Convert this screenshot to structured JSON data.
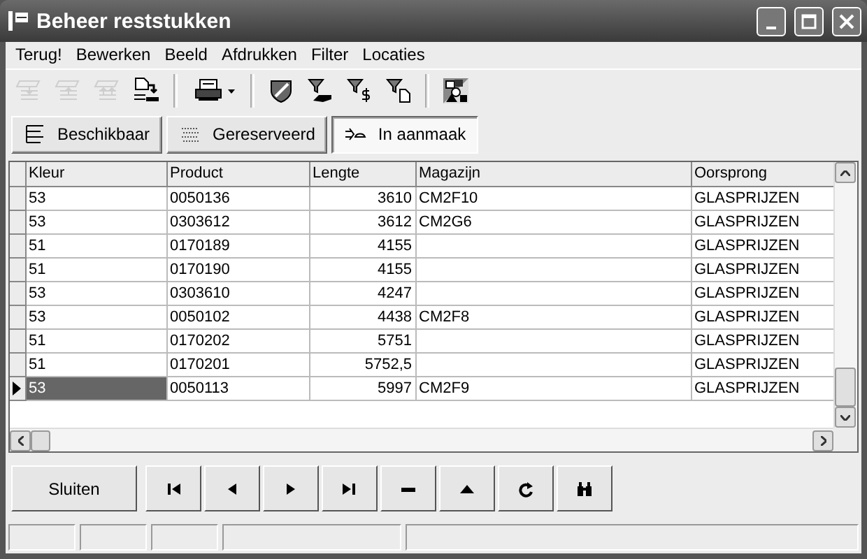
{
  "window": {
    "title": "Beheer reststukken"
  },
  "menu": [
    "Terug!",
    "Bewerken",
    "Beeld",
    "Afdrukken",
    "Filter",
    "Locaties"
  ],
  "toolbar": [
    {
      "kind": "move-down",
      "disabled": true
    },
    {
      "kind": "move-up",
      "disabled": true
    },
    {
      "kind": "move-all-up",
      "disabled": true
    },
    {
      "kind": "document-arrow",
      "disabled": false
    },
    {
      "kind": "separator"
    },
    {
      "kind": "printer",
      "disabled": false
    },
    {
      "kind": "separator"
    },
    {
      "kind": "shield",
      "disabled": false
    },
    {
      "kind": "filter-hand",
      "disabled": false
    },
    {
      "kind": "filter-dollar",
      "disabled": false
    },
    {
      "kind": "filter-page",
      "disabled": false
    },
    {
      "kind": "separator"
    },
    {
      "kind": "shapes",
      "disabled": false
    }
  ],
  "filters": [
    {
      "label": "Beschikbaar",
      "kind": "lines",
      "selected": false
    },
    {
      "label": "Gereserveerd",
      "kind": "dots",
      "selected": false
    },
    {
      "label": "In aanmaak",
      "kind": "arrow",
      "selected": true
    }
  ],
  "table": {
    "columns": [
      "Kleur",
      "Product",
      "Lengte",
      "Magazijn",
      "Oorsprong"
    ],
    "rows": [
      {
        "cells": [
          "53",
          "0050136",
          "3610",
          "CM2F10",
          "GLASPRIJZEN"
        ],
        "selected": false
      },
      {
        "cells": [
          "53",
          "0303612",
          "3612",
          "CM2G6",
          "GLASPRIJZEN"
        ],
        "selected": false
      },
      {
        "cells": [
          "51",
          "0170189",
          "4155",
          "",
          "GLASPRIJZEN"
        ],
        "selected": false
      },
      {
        "cells": [
          "51",
          "0170190",
          "4155",
          "",
          "GLASPRIJZEN"
        ],
        "selected": false
      },
      {
        "cells": [
          "53",
          "0303610",
          "4247",
          "",
          "GLASPRIJZEN"
        ],
        "selected": false
      },
      {
        "cells": [
          "53",
          "0050102",
          "4438",
          "CM2F8",
          "GLASPRIJZEN"
        ],
        "selected": false
      },
      {
        "cells": [
          "51",
          "0170202",
          "5751",
          "",
          "GLASPRIJZEN"
        ],
        "selected": false
      },
      {
        "cells": [
          "51",
          "0170201",
          "5752,5",
          "",
          "GLASPRIJZEN"
        ],
        "selected": false
      },
      {
        "cells": [
          "53",
          "0050113",
          "5997",
          "CM2F9",
          "GLASPRIJZEN"
        ],
        "selected": true
      }
    ]
  },
  "close_button": "Sluiten",
  "navigator": [
    {
      "kind": "first"
    },
    {
      "kind": "prior"
    },
    {
      "kind": "next"
    },
    {
      "kind": "last"
    },
    {
      "kind": "delete"
    },
    {
      "kind": "post"
    },
    {
      "kind": "refresh"
    },
    {
      "kind": "find"
    }
  ]
}
